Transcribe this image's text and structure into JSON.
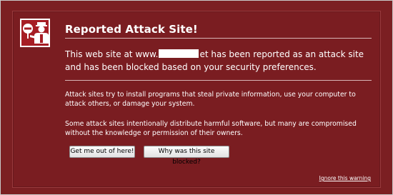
{
  "title": "Reported Attack Site!",
  "message": {
    "prefix": "This web site at www.",
    "suffix": "et has been reported as an attack site and has been blocked based on your security preferences."
  },
  "paragraphs": [
    "Attack sites try to install programs that steal private information, use your computer to attack others, or damage your system.",
    "Some attack sites intentionally distribute harmful software, but many are compromised without the knowledge or permission of their owners."
  ],
  "buttons": {
    "get_out": "Get me out of here!",
    "why_blocked": "Why was this site blocked?"
  },
  "ignore_link": "Ignore this warning",
  "icon": "police-officer-stop-icon",
  "colors": {
    "background": "#7b1f22",
    "text": "#ffffff"
  }
}
